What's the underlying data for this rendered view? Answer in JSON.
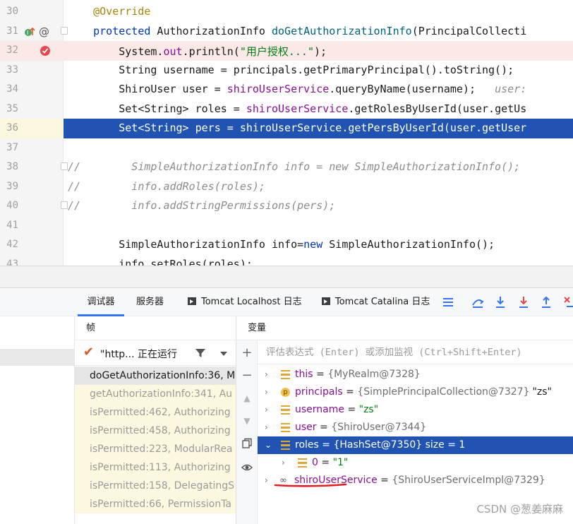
{
  "editor": {
    "lines": [
      {
        "num": "30",
        "segments": [
          {
            "t": "    "
          },
          {
            "t": "@Override",
            "c": "ann"
          }
        ]
      },
      {
        "num": "31",
        "segments": [
          {
            "t": "    "
          },
          {
            "t": "protected",
            "c": "kw"
          },
          {
            "t": " AuthorizationInfo "
          },
          {
            "t": "doGetAuthorizationInfo",
            "c": "fn"
          },
          {
            "t": "(PrincipalCollecti"
          }
        ]
      },
      {
        "num": "32",
        "segments": [
          {
            "t": "        System."
          },
          {
            "t": "out",
            "c": "fld"
          },
          {
            "t": ".println("
          },
          {
            "t": "\"用户授权...\"",
            "c": "str"
          },
          {
            "t": ");"
          }
        ]
      },
      {
        "num": "33",
        "segments": [
          {
            "t": "        String username = principals.getPrimaryPrincipal().toString();"
          }
        ]
      },
      {
        "num": "34",
        "segments": [
          {
            "t": "        ShiroUser user = "
          },
          {
            "t": "shiroUserService",
            "c": "fld"
          },
          {
            "t": ".queryByName(username);  "
          },
          {
            "t": " user:",
            "c": "inlay"
          }
        ]
      },
      {
        "num": "35",
        "segments": [
          {
            "t": "        Set<String> roles = "
          },
          {
            "t": "shiroUserService",
            "c": "fld"
          },
          {
            "t": ".getRolesByUserId(user.getUs"
          }
        ]
      },
      {
        "num": "36",
        "segments": [
          {
            "t": "        Set<String> pers = shiroUserService.getPersByUserId(user.getUser"
          }
        ]
      },
      {
        "num": "37",
        "segments": [
          {
            "t": ""
          }
        ]
      },
      {
        "num": "38",
        "segments": [
          {
            "t": "//        SimpleAuthorizationInfo info = new SimpleAuthorizationInfo();",
            "c": "cmt"
          }
        ]
      },
      {
        "num": "39",
        "segments": [
          {
            "t": "//        info.addRoles(roles);",
            "c": "cmt"
          }
        ]
      },
      {
        "num": "40",
        "segments": [
          {
            "t": "//        info.addStringPermissions(pers);",
            "c": "cmt"
          }
        ]
      },
      {
        "num": "41",
        "segments": [
          {
            "t": ""
          }
        ]
      },
      {
        "num": "42",
        "segments": [
          {
            "t": "        SimpleAuthorizationInfo info="
          },
          {
            "t": "new",
            "c": "kw"
          },
          {
            "t": " SimpleAuthorizationInfo();"
          }
        ]
      },
      {
        "num": "43",
        "segments": [
          {
            "t": "        info.setRoles(roles);"
          }
        ]
      }
    ]
  },
  "tabs": {
    "debugger": "调试器",
    "server": "服务器",
    "tomcat_localhost": "Tomcat Localhost 日志",
    "tomcat_catalina": "Tomcat Catalina 日志"
  },
  "frames": {
    "title": "帧",
    "thread": "\"http... 正在运行",
    "items": [
      "doGetAuthorizationInfo:36, M",
      "getAuthorizationInfo:341, Au",
      "isPermitted:462, Authorizing",
      "isPermitted:458, Authorizing",
      "isPermitted:223, ModularRea",
      "isPermitted:113, Authorizing",
      "isPermitted:158, DelegatingS",
      "isPermitted:66, PermissionTa"
    ]
  },
  "variables": {
    "title": "变量",
    "eval_placeholder": "评估表达式 (Enter) 或添加监视 (Ctrl+Shift+Enter)",
    "rows": [
      {
        "name": "this",
        "value": "{MyRealm@7328}"
      },
      {
        "name": "principals",
        "value": "{SimplePrincipalCollection@7327}",
        "extra": "\"zs\""
      },
      {
        "name": "username",
        "value": "\"zs\""
      },
      {
        "name": "user",
        "value": "{ShiroUser@7344}"
      },
      {
        "name": "roles",
        "value": "{HashSet@7350}  size = 1"
      },
      {
        "name": "0",
        "value": "\"1\""
      },
      {
        "name": "shiroUserService",
        "value": "{ShiroUserServiceImpl@7329}"
      }
    ]
  },
  "watermark": "CSDN @葱姜麻麻",
  "colors": {
    "accent": "#3574f0",
    "selection": "#2154b2",
    "annotation_red": "#e02020"
  }
}
